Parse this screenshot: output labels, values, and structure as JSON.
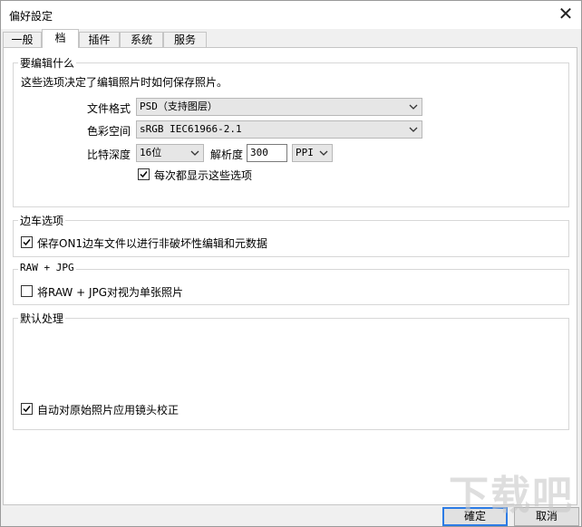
{
  "window": {
    "title": "偏好設定"
  },
  "tabs": [
    {
      "label": "一般",
      "active": false
    },
    {
      "label": "档",
      "active": true
    },
    {
      "label": "插件",
      "active": false
    },
    {
      "label": "系统",
      "active": false
    },
    {
      "label": "服务",
      "active": false
    }
  ],
  "edit_group": {
    "title": "要编辑什么",
    "description": "这些选项决定了编辑照片时如何保存照片。",
    "file_format_label": "文件格式",
    "file_format_value": "PSD（支持图层）",
    "color_space_label": "色彩空间",
    "color_space_value": "sRGB IEC61966-2.1",
    "bit_depth_label": "比特深度",
    "bit_depth_value": "16位",
    "resolution_label": "解析度",
    "resolution_value": "300",
    "resolution_unit": "PPI",
    "show_options_label": "每次都显示这些选项",
    "show_options_checked": true
  },
  "sidecar_group": {
    "title": "边车选项",
    "save_sidecar_label": "保存ON1边车文件以进行非破坏性编辑和元数据",
    "save_sidecar_checked": true
  },
  "raw_group": {
    "title": "RAW + JPG",
    "treat_single_label": "将RAW + JPG对视为单张照片",
    "treat_single_checked": false
  },
  "default_group": {
    "title": "默认处理",
    "lens_correction_label": "自动对原始照片应用镜头校正",
    "lens_correction_checked": true
  },
  "buttons": {
    "ok": "確定",
    "cancel": "取消"
  },
  "watermark": "下载吧"
}
